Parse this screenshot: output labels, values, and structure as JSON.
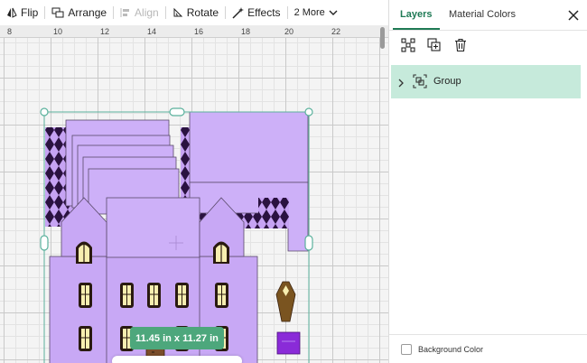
{
  "toolbar": {
    "flip_label": "Flip",
    "arrange_label": "Arrange",
    "align_label": "Align",
    "rotate_label": "Rotate",
    "effects_label": "Effects",
    "more_label": "2 More"
  },
  "ruler": {
    "ticks": [
      "8",
      "10",
      "12",
      "14",
      "16",
      "18",
      "20",
      "22"
    ]
  },
  "canvas": {
    "size_badge": "11.45  in x 11.27  in",
    "colors": {
      "house": "#c8a8f5",
      "roof": "#cdb0f8",
      "diamond": "#2a1240",
      "door": "#7a4d2a",
      "coffin": "#7a5420",
      "gift": "#8a2bd8",
      "window_glow": "#f7eeb0",
      "selection": "#5ab19c"
    }
  },
  "panel": {
    "tab_layers": "Layers",
    "tab_material": "Material Colors",
    "layer_group_label": "Group",
    "bg_color_label": "Background Color",
    "icons": [
      "group-icon",
      "duplicate-icon",
      "delete-icon",
      "close-icon",
      "chevron-right-icon"
    ]
  }
}
